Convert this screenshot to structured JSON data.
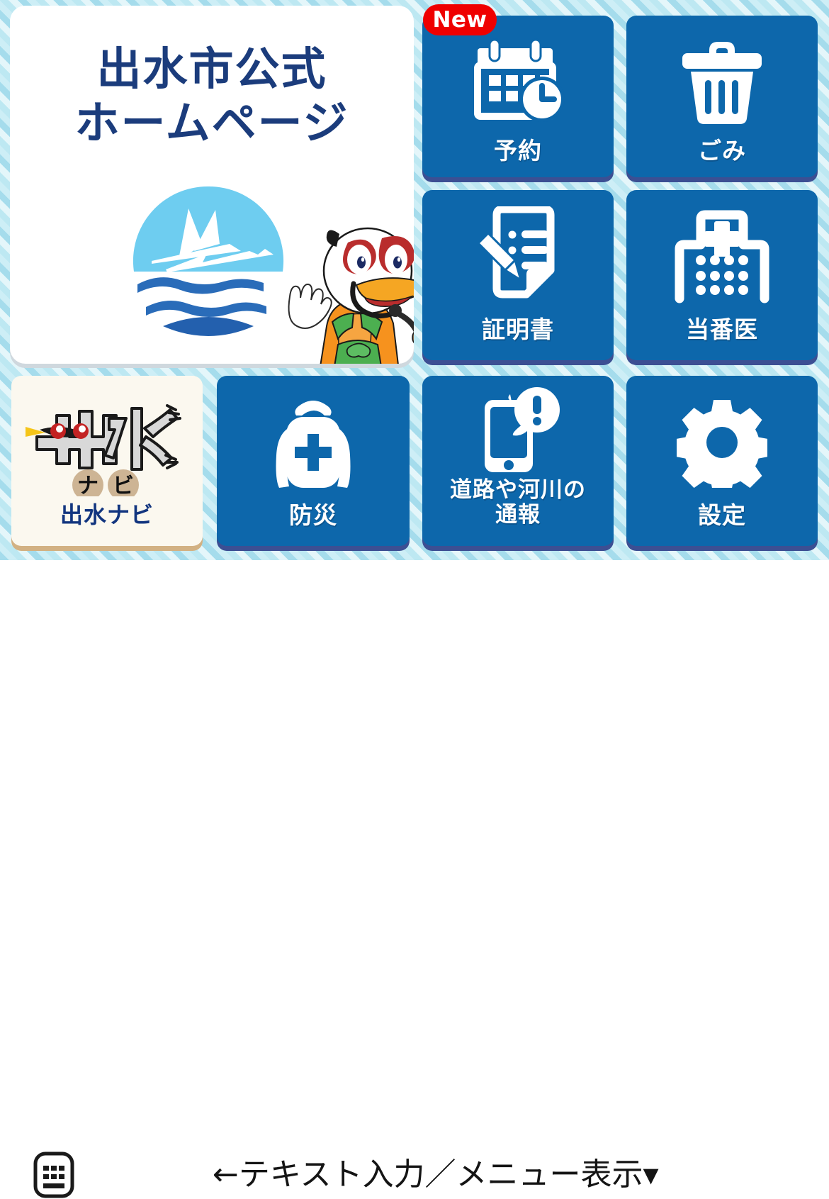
{
  "header": {
    "title_line1": "出水市公式",
    "title_line2": "ホームページ",
    "logo_name": "izumi-city-sailboat-logo",
    "mascot_name": "izumi-crane-mascot",
    "title_color": "#1b3c7c"
  },
  "badges": {
    "new_label": "New",
    "new_color": "#ef0000"
  },
  "colors": {
    "tile_blue": "#0d67ab",
    "tile_blue_shadow": "#3c4f93",
    "tile_cream": "#fbf8ef",
    "tile_cream_shadow": "#d2b183",
    "stripe_light": "#e4f6fa",
    "stripe_dark": "#a5dcec",
    "label_white": "#ffffff"
  },
  "tiles": [
    {
      "id": "reservation",
      "label": "予約",
      "icon": "calendar-clock-icon",
      "badge": "New",
      "style": "blue"
    },
    {
      "id": "garbage",
      "label": "ごみ",
      "icon": "trash-can-icon",
      "badge": null,
      "style": "blue"
    },
    {
      "id": "certificate",
      "label": "証明書",
      "icon": "document-pencil-icon",
      "badge": null,
      "style": "blue"
    },
    {
      "id": "duty-doctor",
      "label": "当番医",
      "icon": "hospital-icon",
      "badge": null,
      "style": "blue"
    },
    {
      "id": "izumi-navi",
      "label": "出水ナビ",
      "icon": "izumi-navi-logo-icon",
      "badge": null,
      "style": "cream"
    },
    {
      "id": "disaster-prevention",
      "label": "防災",
      "icon": "emergency-backpack-icon",
      "badge": null,
      "style": "blue"
    },
    {
      "id": "road-river-report",
      "label_line1": "道路や河川の",
      "label_line2": "通報",
      "label": "道路や河川の通報",
      "icon": "smartphone-alert-icon",
      "badge": null,
      "style": "blue"
    },
    {
      "id": "settings",
      "label": "設定",
      "icon": "gear-icon",
      "badge": null,
      "style": "blue"
    }
  ],
  "bottom_bar": {
    "keyboard_icon": "keyboard-icon",
    "hint_text": "←テキスト入力／メニュー表示▾"
  },
  "izumi_navi_logo": {
    "kanji": "出水",
    "na": "ナ",
    "bi": "ビ"
  }
}
